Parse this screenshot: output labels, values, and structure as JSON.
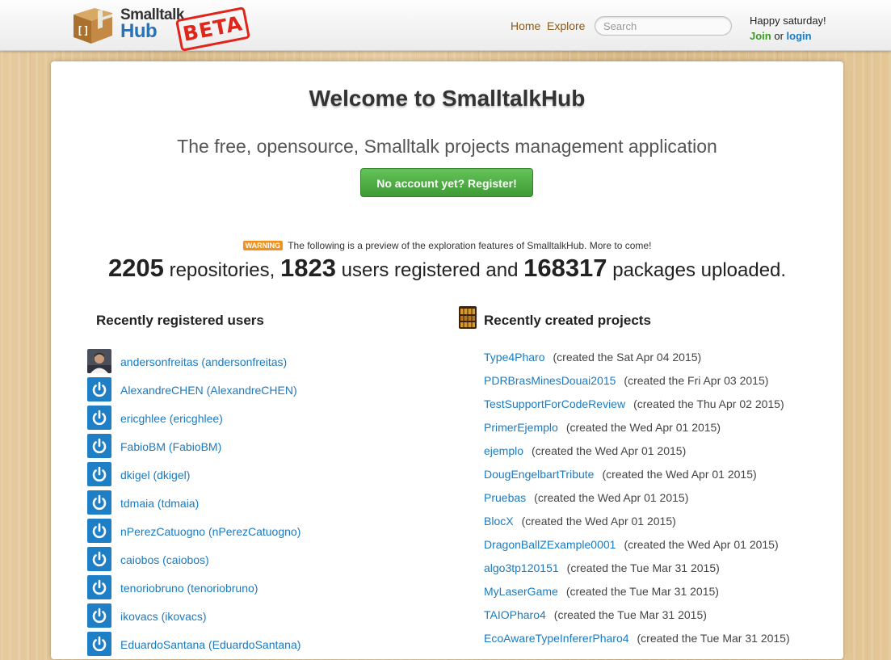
{
  "header": {
    "logo_line1": "Smalltalk",
    "logo_line2": "Hub",
    "beta_label": "BETA",
    "nav": [
      {
        "label": "Home"
      },
      {
        "label": "Explore"
      }
    ],
    "search": {
      "placeholder": "Search",
      "value": ""
    },
    "greeting": "Happy saturday!",
    "join_label": "Join",
    "or_label": "or",
    "login_label": "login"
  },
  "main": {
    "welcome": "Welcome to SmalltalkHub",
    "tagline": "The free, opensource, Smalltalk projects management application",
    "register_button": "No account yet? Register!",
    "warning_badge": "WARNING",
    "notice": "The following is a preview of the exploration features of SmalltalkHub. More to come!",
    "stats": {
      "repositories": "2205",
      "repositories_label": "repositories,",
      "users": "1823",
      "users_label": "users registered and",
      "packages": "168317",
      "packages_label": "packages uploaded."
    },
    "users_title": "Recently registered users",
    "users": [
      {
        "label": "andersonfreitas (andersonfreitas)",
        "avatar": "photo"
      },
      {
        "label": "AlexandreCHEN (AlexandreCHEN)",
        "avatar": "power-icon"
      },
      {
        "label": "ericghlee (ericghlee)",
        "avatar": "power-icon"
      },
      {
        "label": "FabioBM (FabioBM)",
        "avatar": "power-icon"
      },
      {
        "label": "dkigel (dkigel)",
        "avatar": "power-icon"
      },
      {
        "label": "tdmaia (tdmaia)",
        "avatar": "power-icon"
      },
      {
        "label": "nPerezCatuogno (nPerezCatuogno)",
        "avatar": "power-icon"
      },
      {
        "label": "caiobos (caiobos)",
        "avatar": "power-icon"
      },
      {
        "label": "tenoriobruno (tenoriobruno)",
        "avatar": "power-icon"
      },
      {
        "label": "ikovacs (ikovacs)",
        "avatar": "power-icon"
      },
      {
        "label": "EduardoSantana (EduardoSantana)",
        "avatar": "power-icon"
      }
    ],
    "projects_title": "Recently created projects",
    "projects": [
      {
        "name": "Type4Pharo",
        "date": "(created the Sat Apr 04 2015)"
      },
      {
        "name": "PDRBrasMinesDouai2015",
        "date": "(created the Fri Apr 03 2015)"
      },
      {
        "name": "TestSupportForCodeReview",
        "date": "(created the Thu Apr 02 2015)"
      },
      {
        "name": "PrimerEjemplo",
        "date": "(created the Wed Apr 01 2015)"
      },
      {
        "name": "ejemplo",
        "date": "(created the Wed Apr 01 2015)"
      },
      {
        "name": "DougEngelbartTribute",
        "date": "(created the Wed Apr 01 2015)"
      },
      {
        "name": "Pruebas",
        "date": "(created the Wed Apr 01 2015)"
      },
      {
        "name": "BlocX",
        "date": "(created the Wed Apr 01 2015)"
      },
      {
        "name": "DragonBallZExample0001",
        "date": "(created the Wed Apr 01 2015)"
      },
      {
        "name": "algo3tp120151",
        "date": "(created the Tue Mar 31 2015)"
      },
      {
        "name": "MyLaserGame",
        "date": "(created the Tue Mar 31 2015)"
      },
      {
        "name": "TAIOPharo4",
        "date": "(created the Tue Mar 31 2015)"
      },
      {
        "name": "EcoAwareTypeInfererPharo4",
        "date": "(created the Tue Mar 31 2015)"
      }
    ]
  },
  "colors": {
    "link": "#1a7bc0",
    "brand_blue": "#2a72b5",
    "beta_red": "#e0251b",
    "register_green": "#4cae41",
    "warning_orange": "#f0901e"
  }
}
